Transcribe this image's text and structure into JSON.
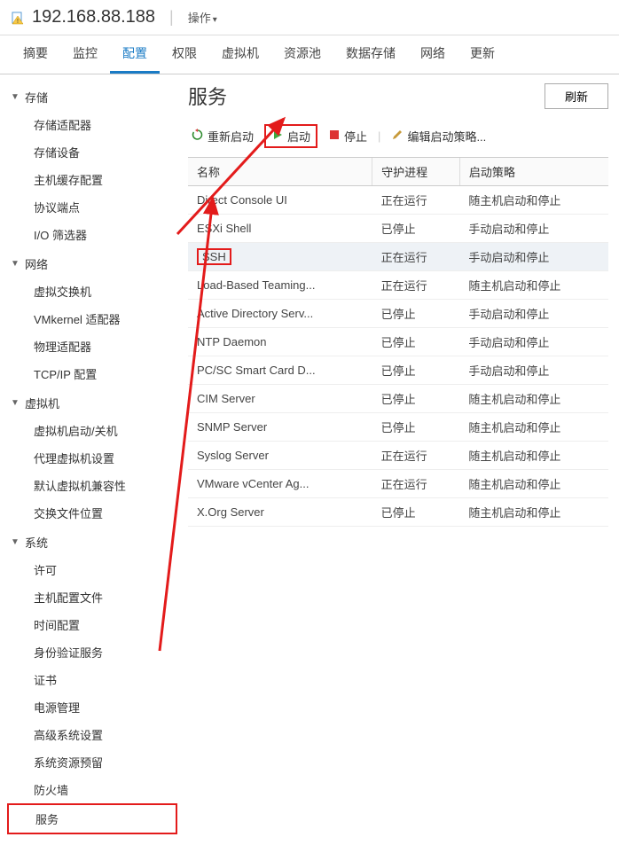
{
  "header": {
    "host": "192.168.88.188",
    "action_label": "操作"
  },
  "tabs": [
    "摘要",
    "监控",
    "配置",
    "权限",
    "虚拟机",
    "资源池",
    "数据存储",
    "网络",
    "更新"
  ],
  "active_tab": 2,
  "sidebar": [
    {
      "label": "存储",
      "items": [
        "存储适配器",
        "存储设备",
        "主机缓存配置",
        "协议端点",
        "I/O 筛选器"
      ]
    },
    {
      "label": "网络",
      "items": [
        "虚拟交换机",
        "VMkernel 适配器",
        "物理适配器",
        "TCP/IP 配置"
      ]
    },
    {
      "label": "虚拟机",
      "items": [
        "虚拟机启动/关机",
        "代理虚拟机设置",
        "默认虚拟机兼容性",
        "交换文件位置"
      ]
    },
    {
      "label": "系统",
      "items": [
        "许可",
        "主机配置文件",
        "时间配置",
        "身份验证服务",
        "证书",
        "电源管理",
        "高级系统设置",
        "系统资源预留",
        "防火墙",
        "服务"
      ]
    }
  ],
  "highlight_sidebar_item": "服务",
  "content": {
    "title": "服务",
    "refresh": "刷新",
    "toolbar": {
      "restart": "重新启动",
      "start": "启动",
      "stop": "停止",
      "edit": "编辑启动策略..."
    },
    "columns": [
      "名称",
      "守护进程",
      "启动策略"
    ],
    "rows": [
      {
        "name": "Direct Console UI",
        "daemon": "正在运行",
        "policy": "随主机启动和停止"
      },
      {
        "name": "ESXi Shell",
        "daemon": "已停止",
        "policy": "手动启动和停止"
      },
      {
        "name": "SSH",
        "daemon": "正在运行",
        "policy": "手动启动和停止",
        "selected": true,
        "highlight_name": true
      },
      {
        "name": "Load-Based Teaming...",
        "daemon": "正在运行",
        "policy": "随主机启动和停止"
      },
      {
        "name": "Active Directory Serv...",
        "daemon": "已停止",
        "policy": "手动启动和停止"
      },
      {
        "name": "NTP Daemon",
        "daemon": "已停止",
        "policy": "手动启动和停止"
      },
      {
        "name": "PC/SC Smart Card D...",
        "daemon": "已停止",
        "policy": "手动启动和停止"
      },
      {
        "name": "CIM Server",
        "daemon": "已停止",
        "policy": "随主机启动和停止"
      },
      {
        "name": "SNMP Server",
        "daemon": "已停止",
        "policy": "随主机启动和停止"
      },
      {
        "name": "Syslog Server",
        "daemon": "正在运行",
        "policy": "随主机启动和停止"
      },
      {
        "name": "VMware vCenter Ag...",
        "daemon": "正在运行",
        "policy": "随主机启动和停止"
      },
      {
        "name": "X.Org Server",
        "daemon": "已停止",
        "policy": "随主机启动和停止"
      }
    ]
  }
}
